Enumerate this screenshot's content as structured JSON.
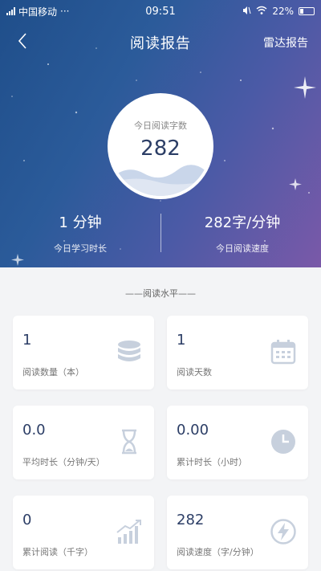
{
  "status_bar": {
    "carrier": "中国移动",
    "dots": "···",
    "time": "09:51",
    "battery_percent": "22%"
  },
  "nav": {
    "title": "阅读报告",
    "right_link": "雷达报告"
  },
  "summary": {
    "today_words_label": "今日阅读字数",
    "today_words_value": "282",
    "study_time_value": "1 分钟",
    "study_time_label": "今日学习时长",
    "speed_value": "282字/分钟",
    "speed_label": "今日阅读速度"
  },
  "section": {
    "title": "——阅读水平——"
  },
  "cards": [
    {
      "value": "1",
      "label": "阅读数量（本）",
      "icon": "database-icon"
    },
    {
      "value": "1",
      "label": "阅读天数",
      "icon": "calendar-icon"
    },
    {
      "value": "0.0",
      "label": "平均时长（分钟/天）",
      "icon": "hourglass-icon"
    },
    {
      "value": "0.00",
      "label": "累计时长（小时）",
      "icon": "clock-icon"
    },
    {
      "value": "0",
      "label": "累计阅读（千字）",
      "icon": "growth-chart-icon"
    },
    {
      "value": "282",
      "label": "阅读速度（字/分钟）",
      "icon": "lightning-icon"
    }
  ],
  "colors": {
    "accent": "#2c3e66",
    "icon": "#c7d0dd"
  }
}
